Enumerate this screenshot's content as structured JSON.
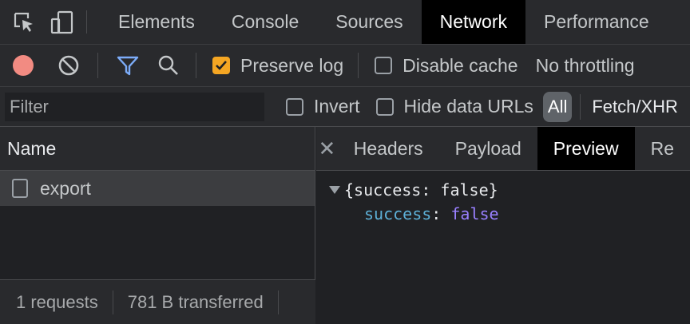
{
  "tabs": {
    "elements": "Elements",
    "console": "Console",
    "sources": "Sources",
    "network": "Network",
    "performance": "Performance"
  },
  "toolbar": {
    "preserve_log_label": "Preserve log",
    "preserve_log_checked": true,
    "disable_cache_label": "Disable cache",
    "disable_cache_checked": false,
    "throttling": "No throttling"
  },
  "filterbar": {
    "filter_placeholder": "Filter",
    "invert_label": "Invert",
    "hide_data_urls_label": "Hide data URLs",
    "type_all": "All",
    "type_fetch_xhr": "Fetch/XHR"
  },
  "requests": {
    "column_name": "Name",
    "rows": [
      {
        "name": "export"
      }
    ]
  },
  "status": {
    "requests": "1 requests",
    "transferred": "781 B transferred"
  },
  "detail": {
    "tabs": [
      "Headers",
      "Payload",
      "Preview",
      "Re"
    ],
    "active_tab": "Preview",
    "preview_summary": "{success: false}",
    "preview_key": "success",
    "preview_colon": ":",
    "preview_value": "false"
  },
  "colors": {
    "accent_checkbox": "#f5a623",
    "record_button": "#f28b82",
    "filter_icon": "#7cacf8",
    "json_key": "#5db0d7",
    "json_boolean": "#9980ff"
  }
}
